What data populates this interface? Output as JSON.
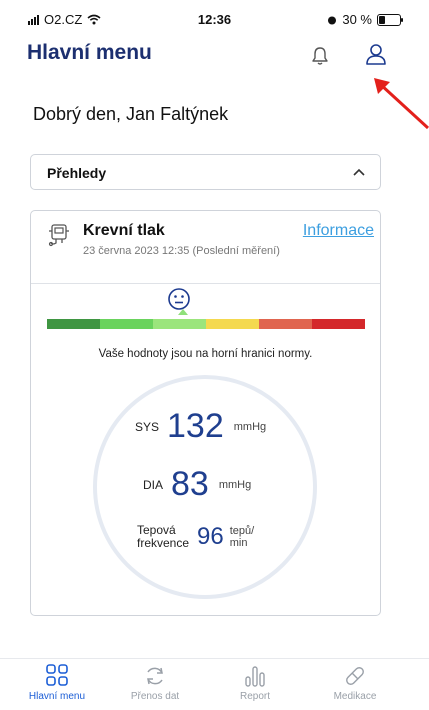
{
  "status_bar": {
    "carrier": "O2.CZ",
    "time": "12:36",
    "battery": "30 %",
    "battery_level": 0.3
  },
  "header": {
    "title": "Hlavní menu"
  },
  "greeting": "Dobrý den, Jan Faltýnek",
  "dropdown": {
    "label": "Přehledy"
  },
  "card": {
    "title": "Krevní tlak",
    "link": "Informace",
    "subtitle": "23 června 2023 12:35 (Poslední měření)",
    "scale_colors": [
      "#3f9642",
      "#6ad35d",
      "#9be57c",
      "#f4d94f",
      "#e0654f",
      "#d4282b"
    ],
    "message": "Vaše hodnoty jsou na horní hranici normy.",
    "sys": {
      "label": "SYS",
      "value": "132",
      "unit": "mmHg"
    },
    "dia": {
      "label": "DIA",
      "value": "83",
      "unit": "mmHg"
    },
    "pulse": {
      "label_line1": "Tepová",
      "label_line2": "frekvence",
      "value": "96",
      "unit_line1": "tepů/",
      "unit_line2": "min"
    }
  },
  "tabs": [
    {
      "label": "Hlavní menu",
      "icon": "grid-icon",
      "active": true
    },
    {
      "label": "Přenos dat",
      "icon": "sync-icon",
      "active": false
    },
    {
      "label": "Report",
      "icon": "chart-icon",
      "active": false
    },
    {
      "label": "Medikace",
      "icon": "pill-icon",
      "active": false
    }
  ]
}
